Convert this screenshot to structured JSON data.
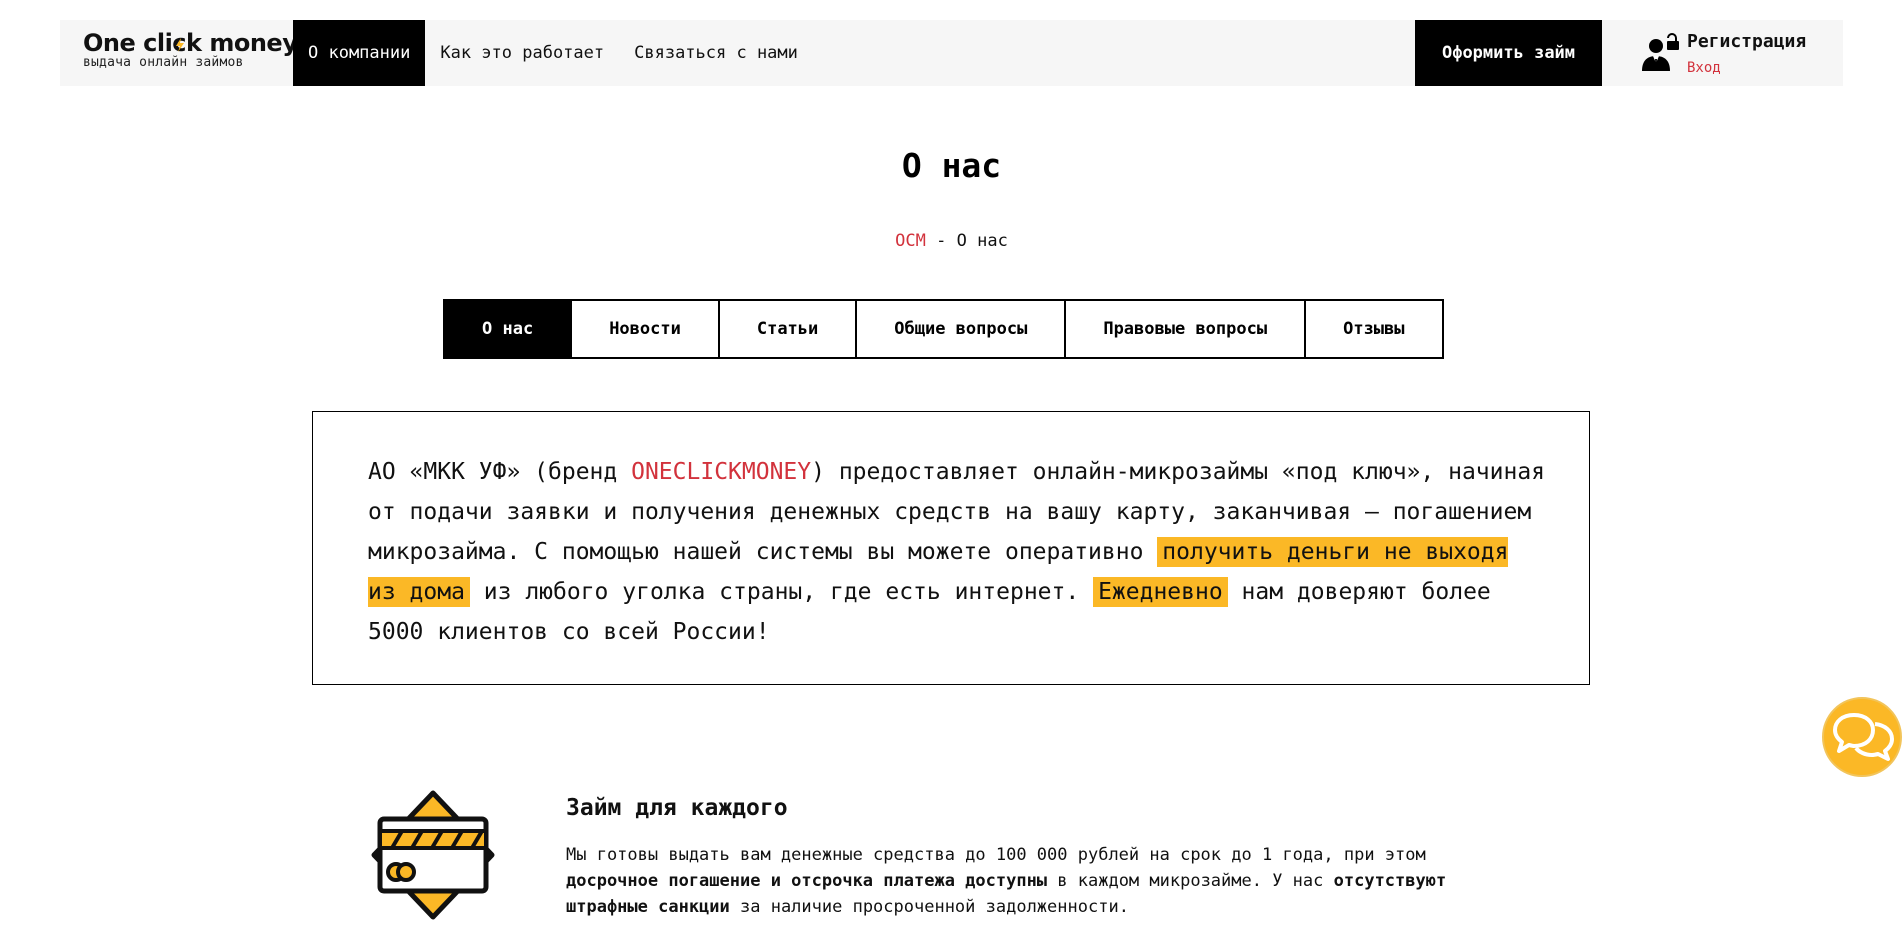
{
  "header": {
    "logo_title": "One click money",
    "logo_subtitle": "выдача онлайн займов",
    "nav": [
      {
        "label": "О компании",
        "active": true
      },
      {
        "label": "Как это работает",
        "active": false
      },
      {
        "label": "Связаться с нами",
        "active": false
      }
    ],
    "cta_label": "Оформить займ",
    "register_label": "Регистрация",
    "login_label": "Вход"
  },
  "page": {
    "title": "О нас",
    "breadcrumb": {
      "root": "OCM",
      "separator": "-",
      "current": "О нас"
    }
  },
  "tabs": [
    {
      "label": "О нас",
      "active": true
    },
    {
      "label": "Новости",
      "active": false
    },
    {
      "label": "Статьи",
      "active": false
    },
    {
      "label": "Общие вопросы",
      "active": false
    },
    {
      "label": "Правовые вопросы",
      "active": false
    },
    {
      "label": "Отзывы",
      "active": false
    }
  ],
  "intro": {
    "part1": "АО «МКК УФ» (бренд ",
    "brand": "ONECLICKMONEY",
    "part2": ") предоставляет онлайн-микрозаймы «под ключ», начиная от подачи заявки и получения денежных средств на вашу карту, заканчивая — погашением микрозайма. С помощью нашей системы вы можете оперативно ",
    "highlight1": "получить деньги не выходя из дома",
    "part3": " из любого уголка страны, где есть интернет. ",
    "highlight2": "Ежедневно",
    "part4": " нам доверяют более 5000 клиентов со всей России!"
  },
  "feature": {
    "title": "Займ для каждого",
    "t1": "Мы готовы выдать вам денежные средства до 100 000 рублей на срок до 1 года, при этом ",
    "b1": "досрочное погашение и отсрочка платежа доступны",
    "t2": " в каждом микрозайме. У нас ",
    "b2": "отсутствуют штрафные санкции",
    "t3": " за наличие просроченной задолженности."
  },
  "icons": {
    "user": "user-lock-icon",
    "feature": "credit-card-icon",
    "chat": "chat-bubbles-icon"
  },
  "colors": {
    "accent": "#fbb826",
    "brand_red": "#d2323c",
    "dark": "#000000",
    "header_bg": "#f6f6f6"
  }
}
